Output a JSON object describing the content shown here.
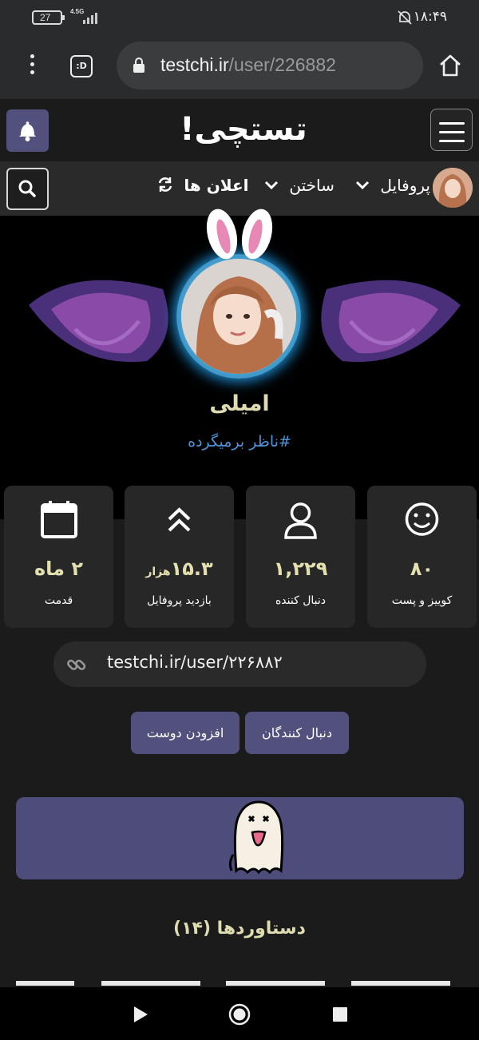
{
  "status_bar": {
    "battery": "27",
    "network": "4.5G",
    "time": "۱۸:۴۹"
  },
  "browser": {
    "url_host": "testchi.ir",
    "url_path": "/user/226882",
    "tab_icon_label": ":D"
  },
  "site": {
    "logo": "تستچی!"
  },
  "nav": {
    "profile_label": "پروفایل",
    "build_label": "ساختن",
    "notifications_label": "اعلان ها"
  },
  "profile": {
    "name": "امیلی",
    "tag": "#ناظر برمیگرده"
  },
  "stats": [
    {
      "icon": "calendar-icon",
      "value": "۲ ماه",
      "suffix": "",
      "label": "قدمت"
    },
    {
      "icon": "double-chevron-up-icon",
      "value": "۱۵.۳",
      "suffix": "هزار",
      "label": "بازدید پروفایل"
    },
    {
      "icon": "user-icon",
      "value": "۱,۲۲۹",
      "suffix": "",
      "label": "دنبال کننده"
    },
    {
      "icon": "smile-icon",
      "value": "۸۰",
      "suffix": "",
      "label": "کوییز و پست"
    }
  ],
  "profile_link": "testchi.ir/user/۲۲۶۸۸۲",
  "buttons": {
    "add_friend": "افزودن دوست",
    "followers": "دنبال کنندگان"
  },
  "achievements_title": "دستاوردها (۱۴)",
  "colors": {
    "accent": "#52517e",
    "card": "#272727",
    "gold_text": "#e4dfae",
    "link_blue": "#4f94d9",
    "ghost_card": "#4e4c7a"
  }
}
